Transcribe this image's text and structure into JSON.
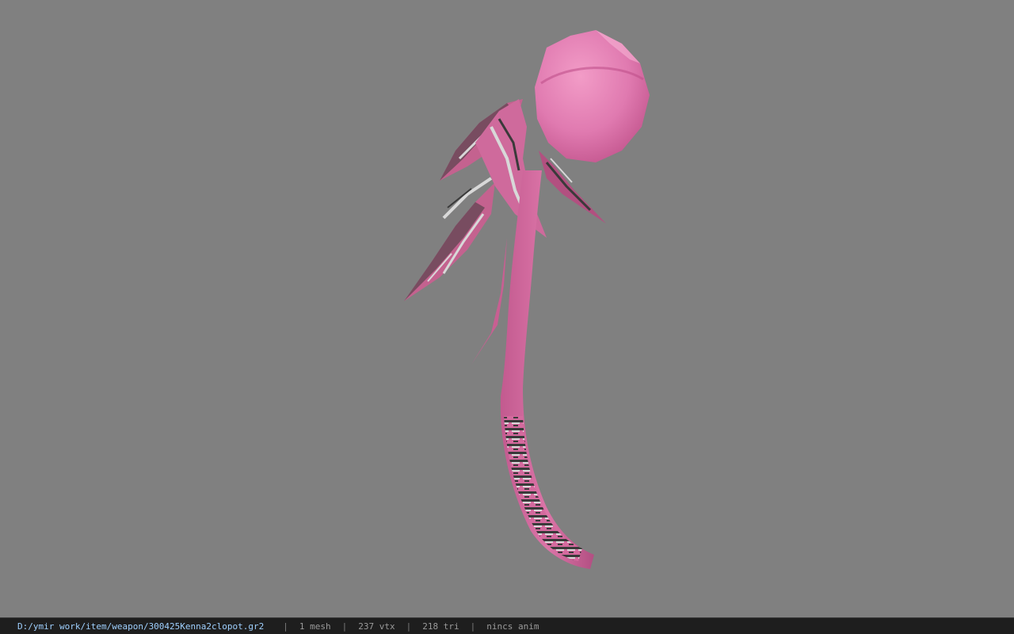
{
  "viewport": {
    "model": "pink-staff-weapon",
    "background_color": "#808080",
    "model_colors": {
      "body": "#d46a9e",
      "body_shade": "#a84a7a",
      "orb": "#e07ab0",
      "orb_highlight": "#f29cc7",
      "pattern_dark": "#3a3a3a",
      "pattern_light": "#d8d8d8"
    }
  },
  "statusbar": {
    "file_path": "D:/ymir work/item/weapon/300425Kenna2clopot.gr2",
    "separator": "|",
    "mesh_count": "1 mesh",
    "vertex_count": "237 vtx",
    "triangle_count": "218 tri",
    "animation": "nincs anim"
  }
}
